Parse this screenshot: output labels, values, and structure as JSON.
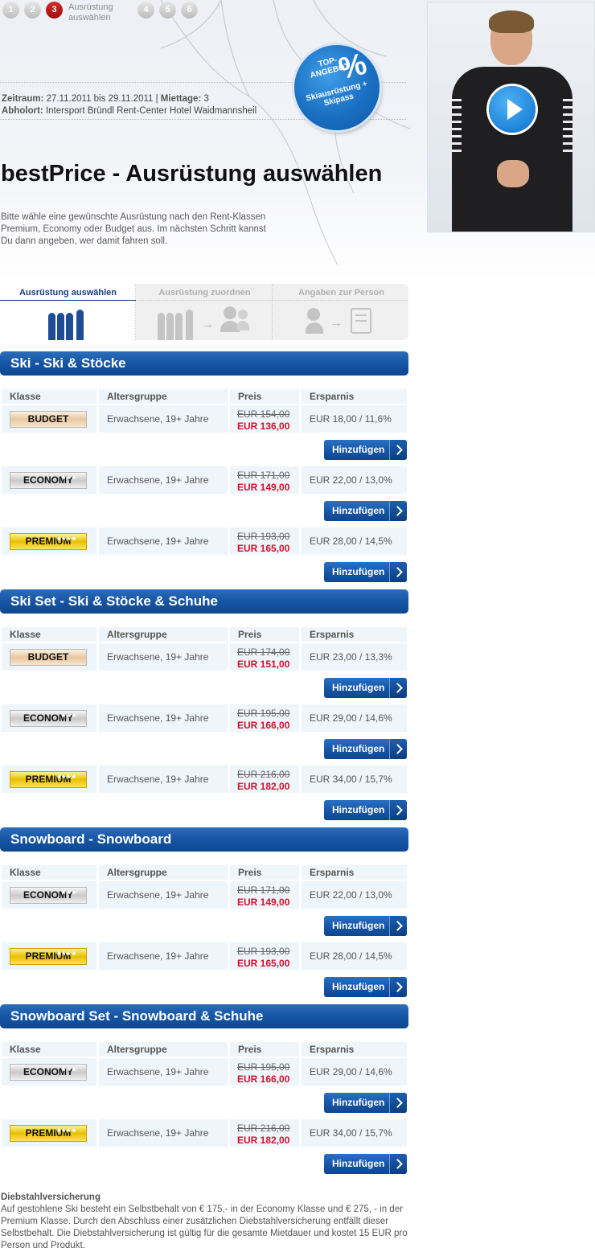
{
  "steps": {
    "items": [
      "1",
      "2",
      "3",
      "4",
      "5",
      "6"
    ],
    "active_index": 2,
    "active_label": "Ausrüstung auswählen"
  },
  "booking": {
    "zeitraum_label": "Zeitraum:",
    "zeitraum_value": "27.11.2011 bis 29.11.2011",
    "mietage_label": "Miettage:",
    "mietage_value": "3",
    "abholort_label": "Abholort:",
    "abholort_value": "Intersport Bründl Rent-Center Hotel Waidmannsheil"
  },
  "offer_badge": {
    "line1": "TOP-ANGEBOT",
    "percent": "%",
    "line2": "Skiausrüstung + Skipass"
  },
  "page_title": "bestPrice - Ausrüstung auswählen",
  "intro": "Bitte wähle eine gewünschte Ausrüstung nach den Rent-Klassen Premium, Economy oder Budget aus. Im nächsten Schritt kannst Du dann angeben, wer damit fahren soll.",
  "wizard": {
    "tabs": [
      {
        "label": "Ausrüstung auswählen",
        "active": true
      },
      {
        "label": "Ausrüstung zuordnen",
        "active": false
      },
      {
        "label": "Angaben zur Person",
        "active": false
      }
    ]
  },
  "table_headers": [
    "Klasse",
    "Altersgruppe",
    "Preis",
    "Ersparnis"
  ],
  "add_label": "Hinzufügen",
  "sections": [
    {
      "title": "Ski - Ski & Stöcke",
      "rows": [
        {
          "class": "BUDGET",
          "age": "Erwachsene, 19+ Jahre",
          "old": "EUR 154,00",
          "new": "EUR 136,00",
          "saving": "EUR 18,00 / 11,6%"
        },
        {
          "class": "ECONOMY",
          "age": "Erwachsene, 19+ Jahre",
          "old": "EUR 171,00",
          "new": "EUR 149,00",
          "saving": "EUR 22,00 / 13,0%"
        },
        {
          "class": "PREMIUM",
          "age": "Erwachsene, 19+ Jahre",
          "old": "EUR 193,00",
          "new": "EUR 165,00",
          "saving": "EUR 28,00 / 14,5%"
        }
      ]
    },
    {
      "title": "Ski Set - Ski & Stöcke & Schuhe",
      "rows": [
        {
          "class": "BUDGET",
          "age": "Erwachsene, 19+ Jahre",
          "old": "EUR 174,00",
          "new": "EUR 151,00",
          "saving": "EUR 23,00 / 13,3%"
        },
        {
          "class": "ECONOMY",
          "age": "Erwachsene, 19+ Jahre",
          "old": "EUR 195,00",
          "new": "EUR 166,00",
          "saving": "EUR 29,00 / 14,6%"
        },
        {
          "class": "PREMIUM",
          "age": "Erwachsene, 19+ Jahre",
          "old": "EUR 216,00",
          "new": "EUR 182,00",
          "saving": "EUR 34,00 / 15,7%"
        }
      ]
    },
    {
      "title": "Snowboard - Snowboard",
      "rows": [
        {
          "class": "ECONOMY",
          "age": "Erwachsene, 19+ Jahre",
          "old": "EUR 171,00",
          "new": "EUR 149,00",
          "saving": "EUR 22,00 / 13,0%"
        },
        {
          "class": "PREMIUM",
          "age": "Erwachsene, 19+ Jahre",
          "old": "EUR 193,00",
          "new": "EUR 165,00",
          "saving": "EUR 28,00 / 14,5%"
        }
      ]
    },
    {
      "title": "Snowboard Set - Snowboard & Schuhe",
      "rows": [
        {
          "class": "ECONOMY",
          "age": "Erwachsene, 19+ Jahre",
          "old": "EUR 195,00",
          "new": "EUR 166,00",
          "saving": "EUR 29,00 / 14,6%"
        },
        {
          "class": "PREMIUM",
          "age": "Erwachsene, 19+ Jahre",
          "old": "EUR 216,00",
          "new": "EUR 182,00",
          "saving": "EUR 34,00 / 15,7%"
        }
      ]
    }
  ],
  "footer": {
    "heading": "Diebstahlversicherung",
    "text": "Auf gestohlene Ski besteht ein Selbstbehalt von € 175,- in der Economy Klasse und € 275, - in der Premium Klasse. Durch den Abschluss einer zusätzlichen Diebstahlversicherung entfällt dieser Selbstbehalt. Die Diebstahlversicherung ist gültig für die gesamte Mietdauer und kostet 15 EUR pro Person und Produkt."
  },
  "colors": {
    "brand_blue": "#1553a2",
    "price_red": "#d0102b",
    "step_active": "#c81e1e"
  }
}
